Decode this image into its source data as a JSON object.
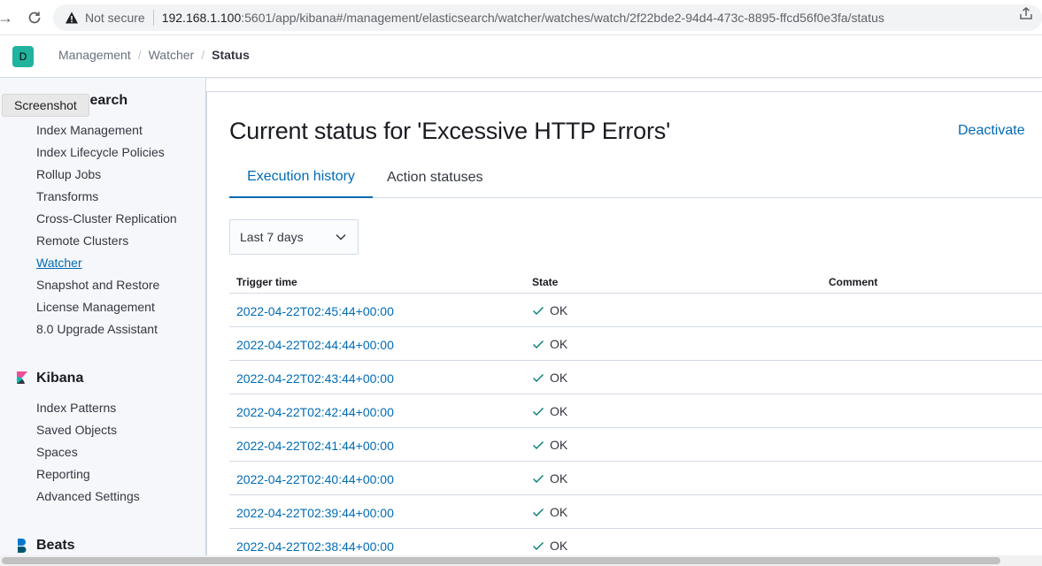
{
  "browser": {
    "security_label": "Not secure",
    "url_host": "192.168.1.100",
    "url_path": ":5601/app/kibana#/management/elasticsearch/watcher/watches/watch/2f22bde2-94d4-473c-8895-ffcd56f0e3fa/status"
  },
  "header": {
    "space_initial": "D",
    "breadcrumbs": [
      "Management",
      "Watcher",
      "Status"
    ]
  },
  "tooltip": "Screenshot",
  "sidebar": {
    "elasticsearch_title": "Elasticsearch",
    "elasticsearch_items": [
      "Index Management",
      "Index Lifecycle Policies",
      "Rollup Jobs",
      "Transforms",
      "Cross-Cluster Replication",
      "Remote Clusters",
      "Watcher",
      "Snapshot and Restore",
      "License Management",
      "8.0 Upgrade Assistant"
    ],
    "kibana_title": "Kibana",
    "kibana_items": [
      "Index Patterns",
      "Saved Objects",
      "Spaces",
      "Reporting",
      "Advanced Settings"
    ],
    "beats_title": "Beats"
  },
  "main": {
    "title": "Current status for 'Excessive HTTP Errors'",
    "deactivate_label": "Deactivate",
    "tabs": [
      "Execution history",
      "Action statuses"
    ],
    "range_label": "Last 7 days",
    "columns": [
      "Trigger time",
      "State",
      "Comment"
    ],
    "rows": [
      {
        "time": "2022-04-22T02:45:44+00:00",
        "state": "OK"
      },
      {
        "time": "2022-04-22T02:44:44+00:00",
        "state": "OK"
      },
      {
        "time": "2022-04-22T02:43:44+00:00",
        "state": "OK"
      },
      {
        "time": "2022-04-22T02:42:44+00:00",
        "state": "OK"
      },
      {
        "time": "2022-04-22T02:41:44+00:00",
        "state": "OK"
      },
      {
        "time": "2022-04-22T02:40:44+00:00",
        "state": "OK"
      },
      {
        "time": "2022-04-22T02:39:44+00:00",
        "state": "OK"
      },
      {
        "time": "2022-04-22T02:38:44+00:00",
        "state": "OK"
      }
    ]
  },
  "colors": {
    "link": "#006bb4",
    "success": "#017d73",
    "space_avatar": "#20b39e"
  }
}
